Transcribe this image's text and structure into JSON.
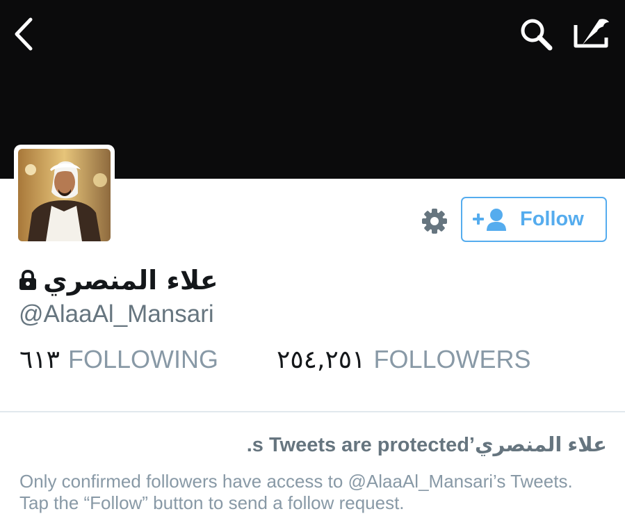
{
  "header": {
    "background_color": "#0b0b0c",
    "back_icon": "chevron-left-icon",
    "search_icon": "search-icon",
    "compose_icon": "compose-quill-icon"
  },
  "profile": {
    "avatar": "profile-photo",
    "display_name": "علاء المنصري",
    "lock_icon": "lock-icon",
    "handle": "@AlaaAl_Mansari",
    "following_count": "٦١٣",
    "following_label": "FOLLOWING",
    "followers_count": "٢٥٤,٢٥١",
    "followers_label": "FOLLOWERS"
  },
  "actions": {
    "settings_icon": "gear-icon",
    "follow_icon": "add-user-icon",
    "follow_label": "Follow",
    "accent_color": "#55acee"
  },
  "protected": {
    "title": "علاء المنصري’s Tweets are protected.",
    "description": "Only confirmed followers have access to @AlaaAl_Mansari’s Tweets. Tap the “Follow” button to send a follow request."
  }
}
